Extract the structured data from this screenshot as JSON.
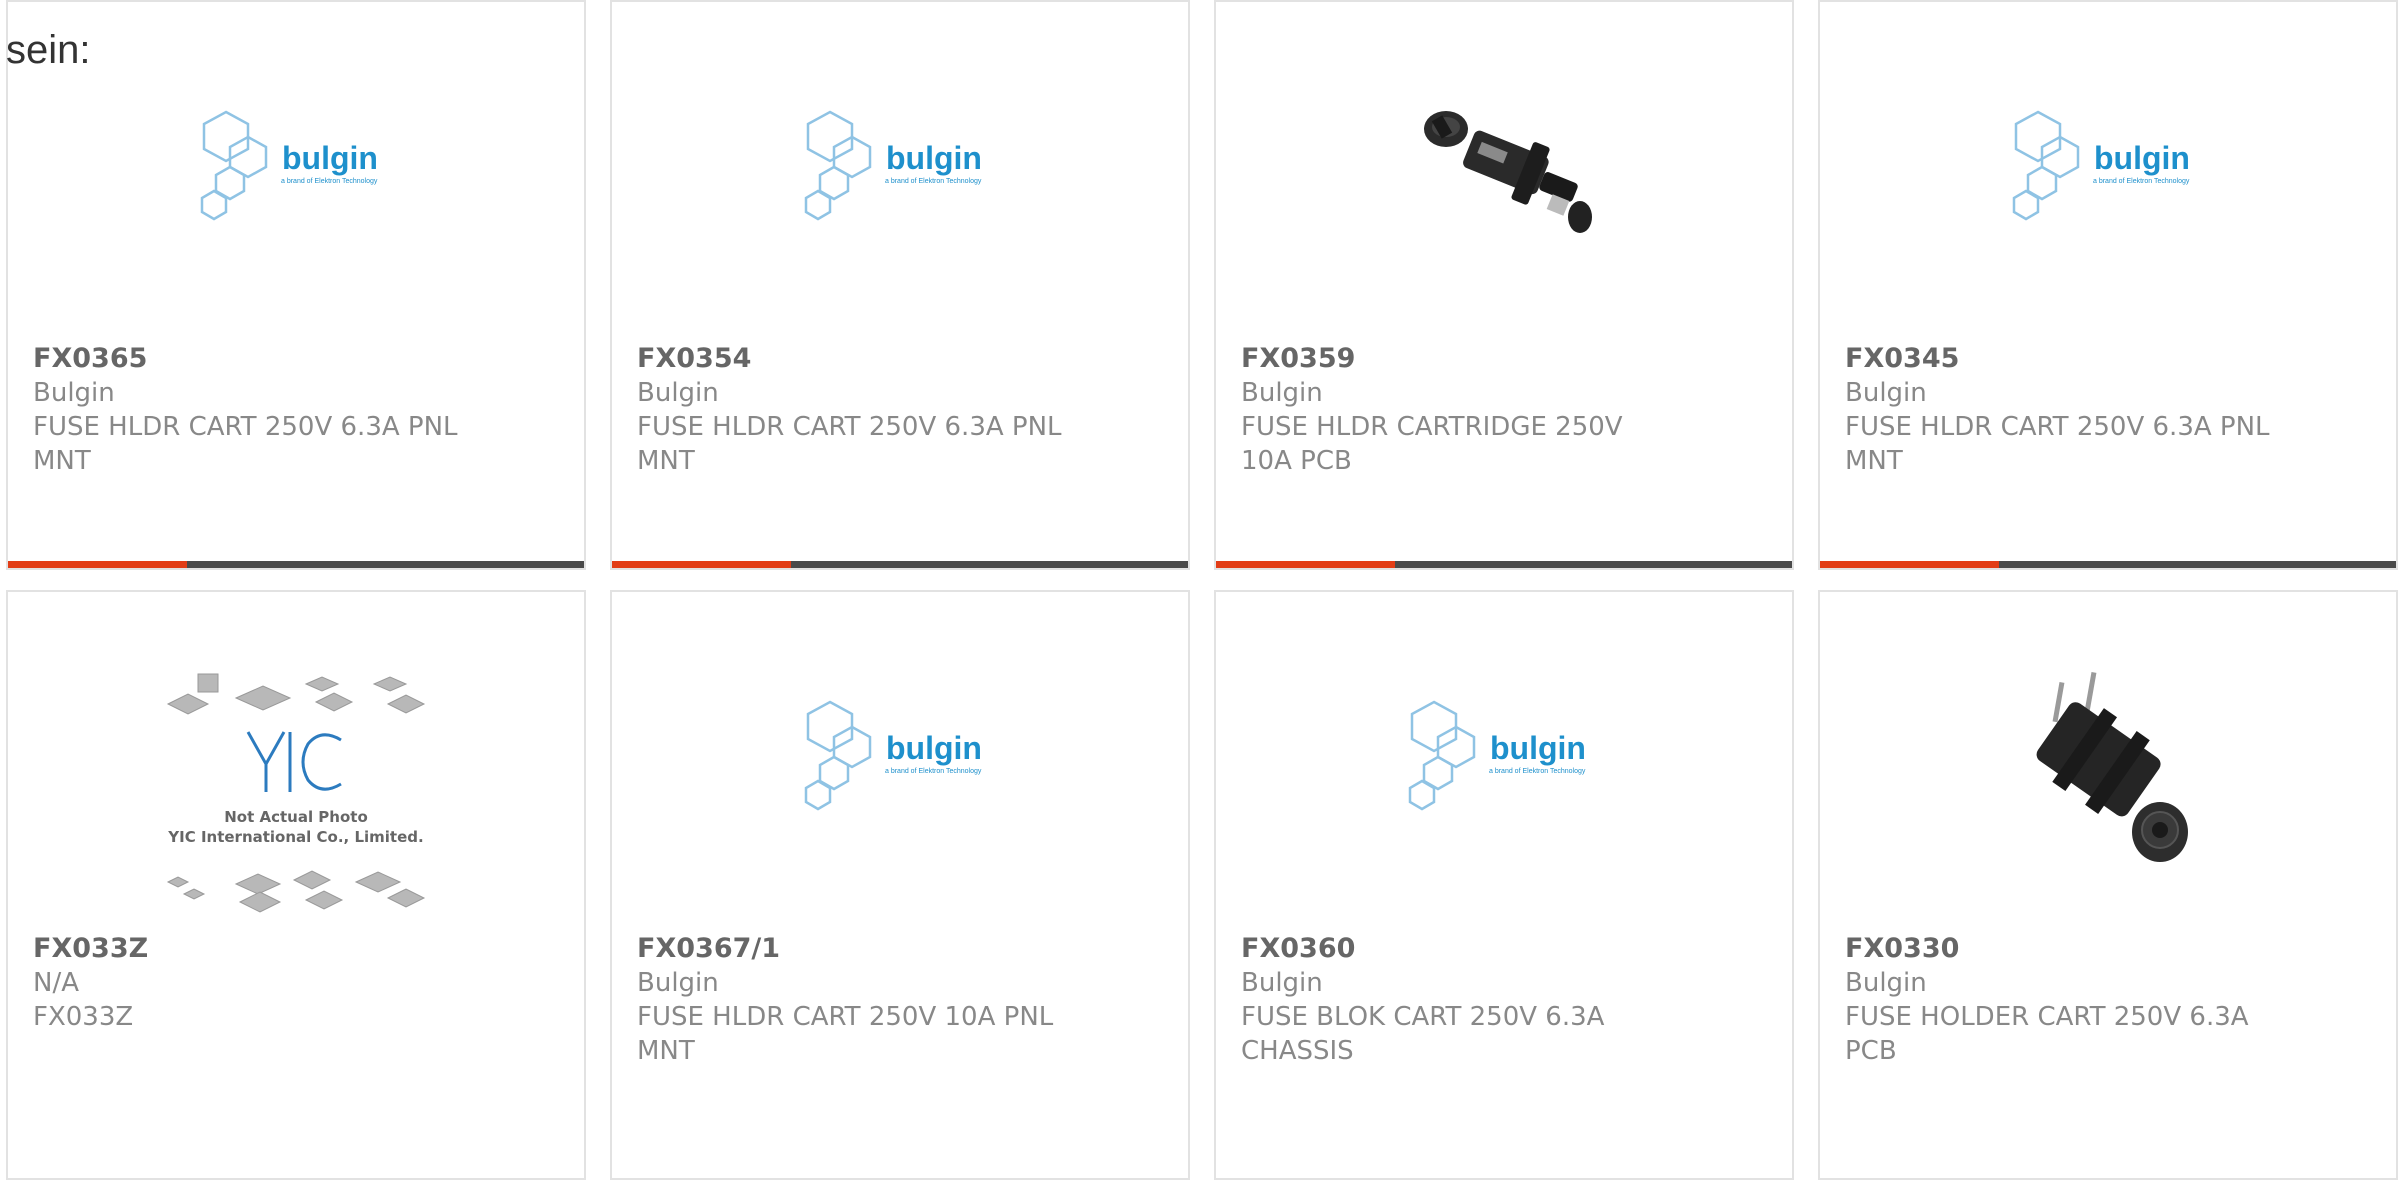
{
  "lead_text": "sein:",
  "colors": {
    "accent": "#e23d16",
    "bar": "#4a4a4a",
    "bulgin_blue": "#1e90cc"
  },
  "cards": [
    {
      "part": "FX0365",
      "manufacturer": "Bulgin",
      "desc_1": "FUSE HLDR CART 250V 6.3A PNL",
      "desc_2": "MNT",
      "image": "bulgin-logo",
      "bulgin": {
        "brand": "bulgin",
        "tagline": "a brand of Elektron Technology"
      },
      "progress": 0.31
    },
    {
      "part": "FX0354",
      "manufacturer": "Bulgin",
      "desc_1": "FUSE HLDR CART 250V 6.3A PNL",
      "desc_2": "MNT",
      "image": "bulgin-logo",
      "bulgin": {
        "brand": "bulgin",
        "tagline": "a brand of Elektron Technology"
      },
      "progress": 0.31
    },
    {
      "part": "FX0359",
      "manufacturer": "Bulgin",
      "desc_1": "FUSE HLDR CARTRIDGE 250V",
      "desc_2": "10A PCB",
      "image": "fuse-holder-photo",
      "progress": 0.31
    },
    {
      "part": "FX0345",
      "manufacturer": "Bulgin",
      "desc_1": "FUSE HLDR CART 250V 6.3A PNL",
      "desc_2": "MNT",
      "image": "bulgin-logo",
      "bulgin": {
        "brand": "bulgin",
        "tagline": "a brand of Elektron Technology"
      },
      "progress": 0.31
    },
    {
      "part": "FX033Z",
      "manufacturer": "N/A",
      "desc_1": "FX033Z",
      "desc_2": "",
      "image": "yic-placeholder",
      "yic": {
        "line1": "Not Actual Photo",
        "line2": "YIC International Co., Limited."
      }
    },
    {
      "part": "FX0367/1",
      "manufacturer": "Bulgin",
      "desc_1": "FUSE HLDR CART 250V 10A PNL",
      "desc_2": "MNT",
      "image": "bulgin-logo",
      "bulgin": {
        "brand": "bulgin",
        "tagline": "a brand of Elektron Technology"
      }
    },
    {
      "part": "FX0360",
      "manufacturer": "Bulgin",
      "desc_1": "FUSE BLOK CART 250V 6.3A",
      "desc_2": "CHASSIS",
      "image": "bulgin-logo",
      "bulgin": {
        "brand": "bulgin",
        "tagline": "a brand of Elektron Technology"
      }
    },
    {
      "part": "FX0330",
      "manufacturer": "Bulgin",
      "desc_1": "FUSE HOLDER CART 250V 6.3A",
      "desc_2": "PCB",
      "image": "fuse-holder-pcb-photo"
    }
  ]
}
